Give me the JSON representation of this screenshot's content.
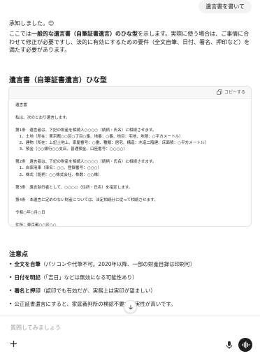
{
  "user_message": "遺言書を書いて",
  "assistant": {
    "greeting": "承知しました。😊",
    "intro_prefix": "ここでは",
    "intro_bold": "一般的な遺言書（自筆証書遺言）のひな型",
    "intro_suffix": "を示します。実際に使う場合は、ご事情に合わせて修正が必要ですし、法的に有効にするための要件（全文自筆、日付、署名、押印など）を満たす必要があります。",
    "section_title": "遺言書（自筆証書遺言）ひな型",
    "copy_label": "コピーする",
    "code_text": "遺言書\n\n私は、次のとおり遺言します。\n\n第1条　遺言者は、下記の財産を相続人○○○○（続柄・氏名）に相続させます。\n　1．土地（所在：東京都○○区○丁目○番、地番：○番、地目：宅地、地積：○平方メートル）\n　2．建物（所在：上記土地上、家屋番号：○番、種類：居宅、構造：木造二階建、床面積：○平方メートル）\n　3．預金（○○銀行○○支店、普通預金、口座番号：○○○○）\n\n第2条　遺言者は、下記の財産を相続人○○○○（続柄・氏名）に相続させます。\n　1．自家用車（車名：○○、登録番号：○○○）\n　2．株式（銘柄：○○株式会社、株数：○○株）\n\n第3条　遺言執行者として、○○○○（住所・氏名）を指定します。\n\n第4条　本遺言に定めのない財産については、法定相続分に従って相続させます。\n\n令和○年○月○日\n\n住所：東京都○○区○○\n氏名：○○○○（自署）\n印",
    "notes_title": "注意点",
    "notes": [
      {
        "bullet": "•",
        "bold": "全文を自筆",
        "text": "（パソコンや代筆不可。2020年以降、一部の財産目録は印刷可）"
      },
      {
        "bullet": "•",
        "bold": "日付を明記",
        "text": "（「吉日」などは無効になる可能性あり）"
      },
      {
        "bullet": "•",
        "bold": "署名と押印",
        "text": "（認印でも有効だが、実務上は実印が望ましい）"
      },
      {
        "bullet": "•",
        "bold": "",
        "text": "公正証書遺言にすると、家庭裁判所の検認不要で確実性が高いです。"
      }
    ]
  },
  "composer": {
    "placeholder": "質問してみましょう"
  },
  "icons": {
    "copy": "copy-icon",
    "scroll_down": "arrow-down-icon",
    "plus": "plus-icon",
    "mic": "microphone-icon",
    "voice": "voice-waveform-icon"
  }
}
